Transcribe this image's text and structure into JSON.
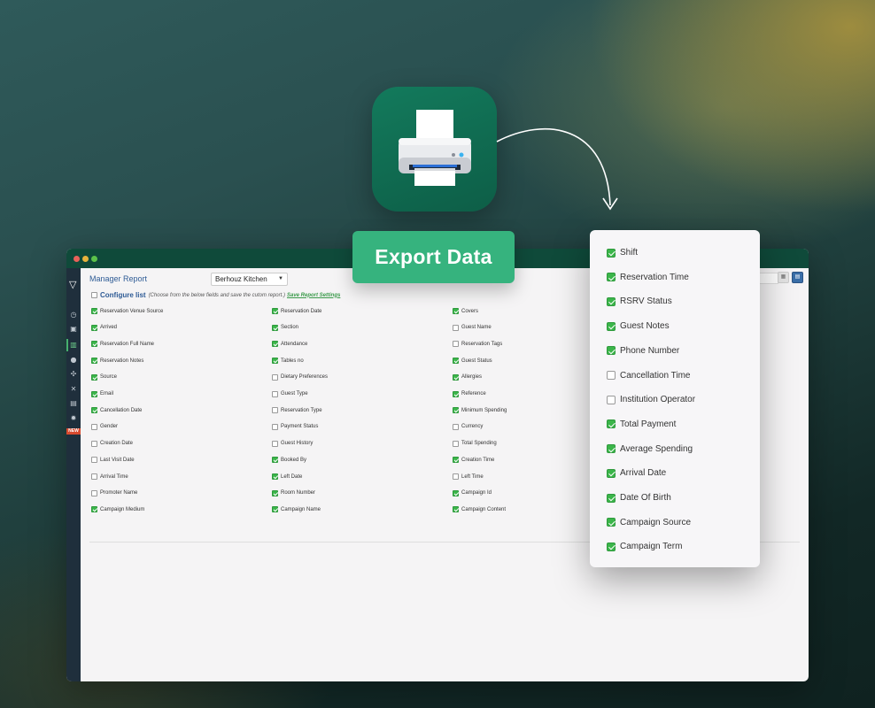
{
  "export_button": {
    "label": "Export Data"
  },
  "window": {
    "report_title": "Manager Report",
    "venue_select": "Berhouz Kitchen",
    "config": {
      "title": "Configure list",
      "hint": "(Choose from the below fields and save the cutom report.)",
      "save_link": "Save Report Settings",
      "checked": false
    },
    "sidebar": {
      "new_badge": "NEW"
    },
    "fields": [
      [
        {
          "label": "Reservation Venue Source",
          "checked": true
        },
        {
          "label": "Arrived",
          "checked": true
        },
        {
          "label": "Reservation Full Name",
          "checked": true
        },
        {
          "label": "Reservation Notes",
          "checked": true
        },
        {
          "label": "Source",
          "checked": true
        },
        {
          "label": "Email",
          "checked": true
        },
        {
          "label": "Cancellation Date",
          "checked": true
        },
        {
          "label": "Gender",
          "checked": false
        },
        {
          "label": "Creation Date",
          "checked": false
        },
        {
          "label": "Last Visit Date",
          "checked": false
        },
        {
          "label": "Arrival Time",
          "checked": false
        },
        {
          "label": "Promoter Name",
          "checked": false
        },
        {
          "label": "Campaign Medium",
          "checked": true
        }
      ],
      [
        {
          "label": "Reservation Date",
          "checked": true
        },
        {
          "label": "Section",
          "checked": true
        },
        {
          "label": "Attendance",
          "checked": true
        },
        {
          "label": "Tables no",
          "checked": true
        },
        {
          "label": "Dietary Preferences",
          "checked": false
        },
        {
          "label": "Guest Type",
          "checked": false
        },
        {
          "label": "Reservation Type",
          "checked": false
        },
        {
          "label": "Payment Status",
          "checked": false
        },
        {
          "label": "Guest History",
          "checked": false
        },
        {
          "label": "Booked By",
          "checked": true
        },
        {
          "label": "Left Date",
          "checked": true
        },
        {
          "label": "Room Number",
          "checked": true
        },
        {
          "label": "Campaign Name",
          "checked": true
        }
      ],
      [
        {
          "label": "Covers",
          "checked": true
        },
        {
          "label": "Guest Name",
          "checked": false
        },
        {
          "label": "Reservation Tags",
          "checked": false
        },
        {
          "label": "Guest Status",
          "checked": true
        },
        {
          "label": "Allergies",
          "checked": true
        },
        {
          "label": "Reference",
          "checked": true
        },
        {
          "label": "Minimum Spending",
          "checked": true
        },
        {
          "label": "Currency",
          "checked": false
        },
        {
          "label": "Total Spending",
          "checked": false
        },
        {
          "label": "Creation Time",
          "checked": true
        },
        {
          "label": "Left Time",
          "checked": false
        },
        {
          "label": "Campaign Id",
          "checked": true
        },
        {
          "label": "Campaign Content",
          "checked": true
        }
      ]
    ]
  },
  "popup": {
    "items": [
      {
        "label": "Shift",
        "checked": true
      },
      {
        "label": "Reservation Time",
        "checked": true
      },
      {
        "label": "RSRV Status",
        "checked": true
      },
      {
        "label": "Guest Notes",
        "checked": true
      },
      {
        "label": "Phone Number",
        "checked": true
      },
      {
        "label": "Cancellation Time",
        "checked": false
      },
      {
        "label": "Institution Operator",
        "checked": false
      },
      {
        "label": "Total Payment",
        "checked": true
      },
      {
        "label": "Average Spending",
        "checked": true
      },
      {
        "label": "Arrival Date",
        "checked": true
      },
      {
        "label": "Date Of Birth",
        "checked": true
      },
      {
        "label": "Campaign Source",
        "checked": true
      },
      {
        "label": "Campaign Term",
        "checked": true
      }
    ]
  },
  "colors": {
    "accent_green": "#36b37e",
    "checkbox_green": "#3bb54a",
    "titlebar": "#0f4a3a",
    "sidebar": "#1f2f3c",
    "link_blue": "#2e5b95"
  }
}
